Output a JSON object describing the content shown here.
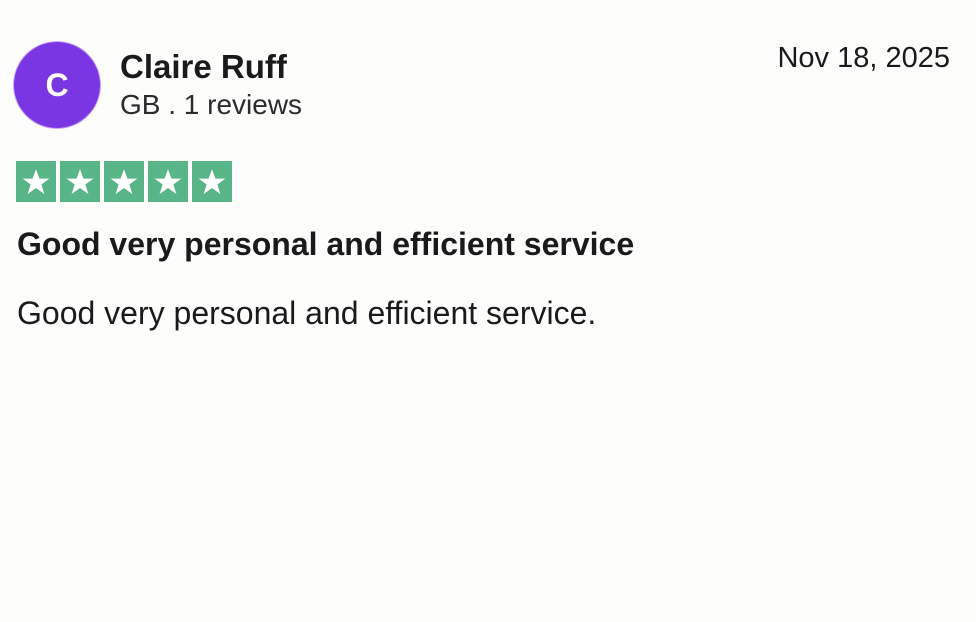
{
  "review": {
    "avatar_initial": "C",
    "author_name": "Claire Ruff",
    "author_meta": "GB . 1 reviews",
    "date": "Nov 18, 2025",
    "rating": 5,
    "rating_max": 5,
    "title": "Good very personal and efficient service",
    "body": "Good very personal and efficient service."
  },
  "icons": {
    "star": "star-icon"
  },
  "colors": {
    "avatar_bg": "#7b36e4",
    "star_bg": "#58b587",
    "text": "#1a1a1a"
  }
}
